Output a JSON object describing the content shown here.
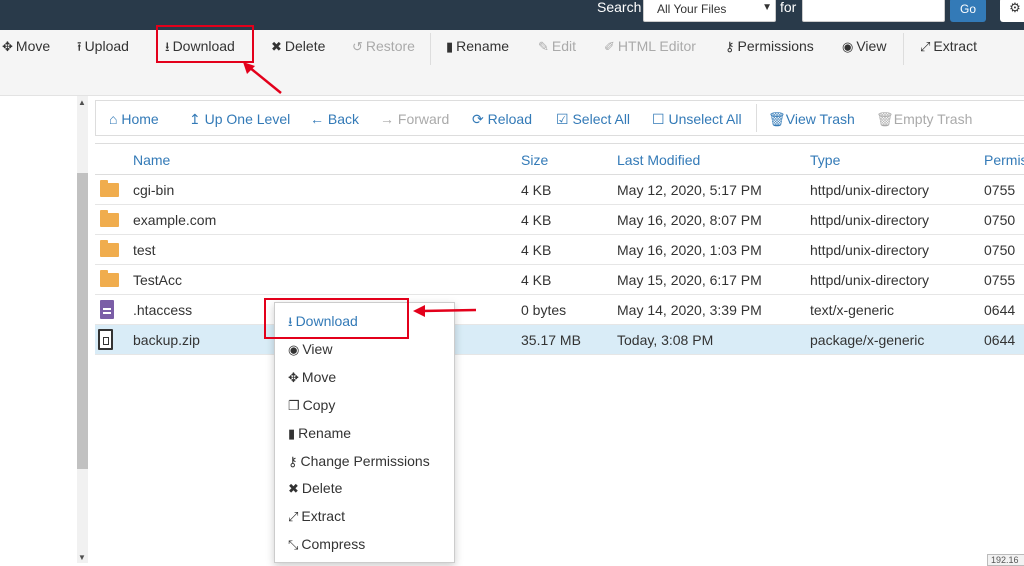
{
  "topbar": {
    "search_label": "Search",
    "search_scope": "All Your Files",
    "for_label": "for",
    "search_query": "",
    "go_label": "Go",
    "settings_icon": "gear-icon"
  },
  "toolbar": {
    "items": [
      {
        "label": "Move",
        "icon": "move-icon",
        "glyph": "✥"
      },
      {
        "label": "Upload",
        "icon": "upload-icon",
        "glyph": "⭱"
      },
      {
        "label": "Download",
        "icon": "download-icon",
        "glyph": "⭳"
      },
      {
        "label": "Delete",
        "icon": "delete-icon",
        "glyph": "✖"
      },
      {
        "label": "Restore",
        "icon": "restore-icon",
        "glyph": "↺"
      },
      {
        "label": "Rename",
        "icon": "rename-icon",
        "glyph": "▮"
      },
      {
        "label": "Edit",
        "icon": "pencil-icon",
        "glyph": "✎"
      },
      {
        "label": "HTML Editor",
        "icon": "html-editor-icon",
        "glyph": "✐"
      },
      {
        "label": "Permissions",
        "icon": "key-icon",
        "glyph": "⚷"
      },
      {
        "label": "View",
        "icon": "eye-icon",
        "glyph": "◉"
      },
      {
        "label": "Extract",
        "icon": "extract-icon",
        "glyph": "⤢"
      }
    ]
  },
  "nav": {
    "items": [
      {
        "label": "Home",
        "glyph": "⌂"
      },
      {
        "label": "Up One Level",
        "glyph": "↥"
      },
      {
        "label": "Back",
        "glyph": "←"
      },
      {
        "label": "Forward",
        "glyph": "→"
      },
      {
        "label": "Reload",
        "glyph": "⟳"
      },
      {
        "label": "Select All",
        "glyph": "☑"
      },
      {
        "label": "Unselect All",
        "glyph": "☐"
      },
      {
        "label": "View Trash",
        "glyph": "🗑"
      },
      {
        "label": "Empty Trash",
        "glyph": "🗑"
      }
    ]
  },
  "table": {
    "columns": [
      "Name",
      "Size",
      "Last Modified",
      "Type",
      "Permis"
    ],
    "rows": [
      {
        "name": "cgi-bin",
        "size": "4 KB",
        "modified": "May 12, 2020, 5:17 PM",
        "type": "httpd/unix-directory",
        "perms": "0755",
        "kind": "folder"
      },
      {
        "name": "example.com",
        "size": "4 KB",
        "modified": "May 16, 2020, 8:07 PM",
        "type": "httpd/unix-directory",
        "perms": "0750",
        "kind": "folder"
      },
      {
        "name": "test",
        "size": "4 KB",
        "modified": "May 16, 2020, 1:03 PM",
        "type": "httpd/unix-directory",
        "perms": "0750",
        "kind": "folder"
      },
      {
        "name": "TestAcc",
        "size": "4 KB",
        "modified": "May 15, 2020, 6:17 PM",
        "type": "httpd/unix-directory",
        "perms": "0755",
        "kind": "folder"
      },
      {
        "name": ".htaccess",
        "size": "0 bytes",
        "modified": "May 14, 2020, 3:39 PM",
        "type": "text/x-generic",
        "perms": "0644",
        "kind": "file"
      },
      {
        "name": "backup.zip",
        "size": "35.17 MB",
        "modified": "Today, 3:08 PM",
        "type": "package/x-generic",
        "perms": "0644",
        "kind": "zip"
      }
    ]
  },
  "context_menu": {
    "items": [
      {
        "label": "Download",
        "glyph": "⭳"
      },
      {
        "label": "View",
        "glyph": "◉"
      },
      {
        "label": "Move",
        "glyph": "✥"
      },
      {
        "label": "Copy",
        "glyph": "❐"
      },
      {
        "label": "Rename",
        "glyph": "▮"
      },
      {
        "label": "Change Permissions",
        "glyph": "⚷"
      },
      {
        "label": "Delete",
        "glyph": "✖"
      },
      {
        "label": "Extract",
        "glyph": "⤢"
      },
      {
        "label": "Compress",
        "glyph": "⤡"
      }
    ]
  },
  "status": {
    "ip_fragment": "192.16"
  },
  "colors": {
    "accent": "#337ab7",
    "highlight": "#e3001b",
    "topbar": "#293a4a",
    "selected_row": "#d9ecf7"
  }
}
